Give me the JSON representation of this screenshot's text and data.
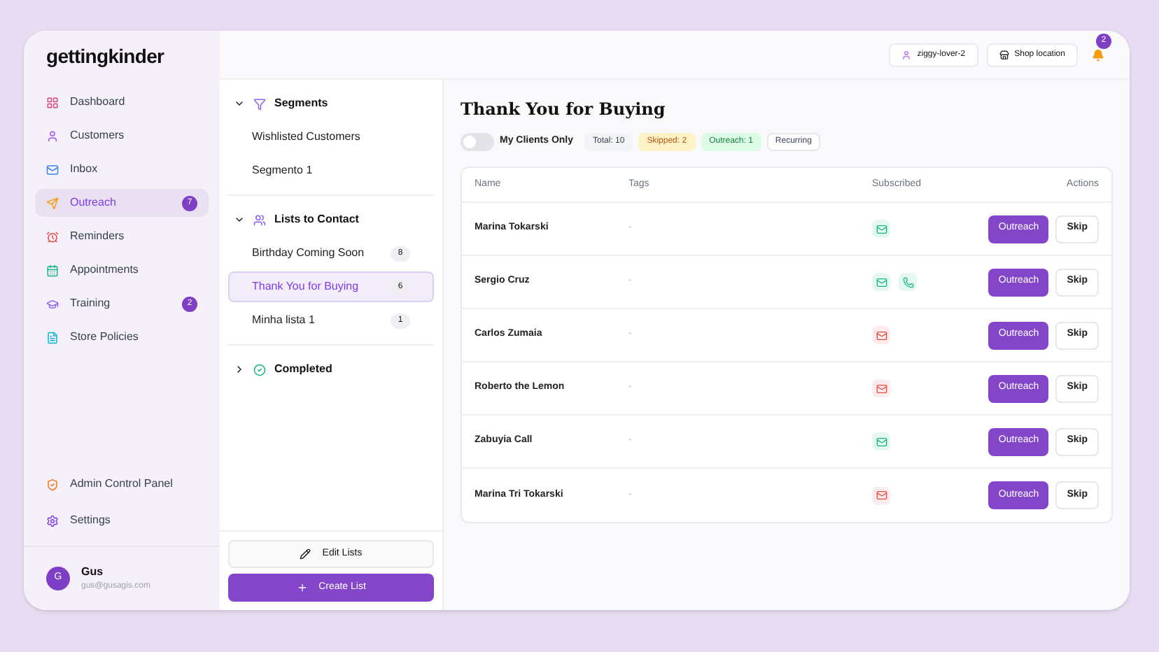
{
  "logo": "gettingkinder",
  "sidebar": {
    "items": [
      {
        "label": "Dashboard",
        "selected": false
      },
      {
        "label": "Customers",
        "selected": false
      },
      {
        "label": "Inbox",
        "selected": false
      },
      {
        "label": "Outreach",
        "selected": true,
        "badge": "7"
      },
      {
        "label": "Reminders",
        "selected": false
      },
      {
        "label": "Appointments",
        "selected": false
      },
      {
        "label": "Training",
        "selected": false,
        "badge": "2"
      },
      {
        "label": "Store Policies",
        "selected": false
      }
    ],
    "bottom_items": [
      {
        "label": "Admin Control Panel"
      },
      {
        "label": "Settings"
      }
    ],
    "user": {
      "initial": "G",
      "name": "Gus",
      "email": "gus@gusagis.com"
    }
  },
  "lists_panel": {
    "sections": [
      {
        "title": "Segments",
        "expanded": true,
        "items": [
          {
            "label": "Wishlisted Customers",
            "selected": false
          },
          {
            "label": "Segmento 1",
            "selected": false
          }
        ]
      },
      {
        "title": "Lists to Contact",
        "expanded": true,
        "items": [
          {
            "label": "Birthday Coming Soon",
            "count": "8",
            "selected": false
          },
          {
            "label": "Thank You for Buying",
            "count": "6",
            "selected": true
          },
          {
            "label": "Minha lista 1",
            "count": "1",
            "selected": false
          }
        ]
      },
      {
        "title": "Completed",
        "expanded": false
      }
    ],
    "edit_button": "Edit Lists",
    "create_button": "Create List"
  },
  "header": {
    "user_chip": "ziggy-lover-2",
    "location_button": "Shop location",
    "notification_count": "2"
  },
  "main": {
    "title": "Thank You for Buying",
    "my_clients_toggle": {
      "label": "My Clients Only",
      "on": false
    },
    "chips": [
      {
        "kind": "neutral",
        "label": "Total: 10"
      },
      {
        "kind": "warning",
        "label": "Skipped: 2"
      },
      {
        "kind": "success",
        "label": "Outreach: 1"
      },
      {
        "kind": "outline",
        "label": "Recurring"
      }
    ],
    "table": {
      "columns": [
        "Name",
        "Tags",
        "Subscribed",
        "Actions"
      ],
      "rows": [
        {
          "name": "Marina Tokarski",
          "tags": "-",
          "channels": [
            {
              "kind": "email",
              "subscribed": true
            }
          ],
          "outreach": "Outreach",
          "skip": "Skip"
        },
        {
          "name": "Sergio Cruz",
          "tags": "-",
          "channels": [
            {
              "kind": "email",
              "subscribed": true
            },
            {
              "kind": "phone",
              "subscribed": true
            }
          ],
          "outreach": "Outreach",
          "skip": "Skip"
        },
        {
          "name": "Carlos Zumaia",
          "tags": "-",
          "channels": [
            {
              "kind": "email",
              "subscribed": false
            }
          ],
          "outreach": "Outreach",
          "skip": "Skip"
        },
        {
          "name": "Roberto the Lemon",
          "tags": "-",
          "channels": [
            {
              "kind": "email",
              "subscribed": false
            }
          ],
          "outreach": "Outreach",
          "skip": "Skip"
        },
        {
          "name": "Zabuyia Call",
          "tags": "-",
          "channels": [
            {
              "kind": "email",
              "subscribed": true
            }
          ],
          "outreach": "Outreach",
          "skip": "Skip"
        },
        {
          "name": "Marina Tri Tokarski",
          "tags": "-",
          "channels": [
            {
              "kind": "email",
              "subscribed": false
            }
          ],
          "outreach": "Outreach",
          "skip": "Skip"
        }
      ]
    }
  }
}
